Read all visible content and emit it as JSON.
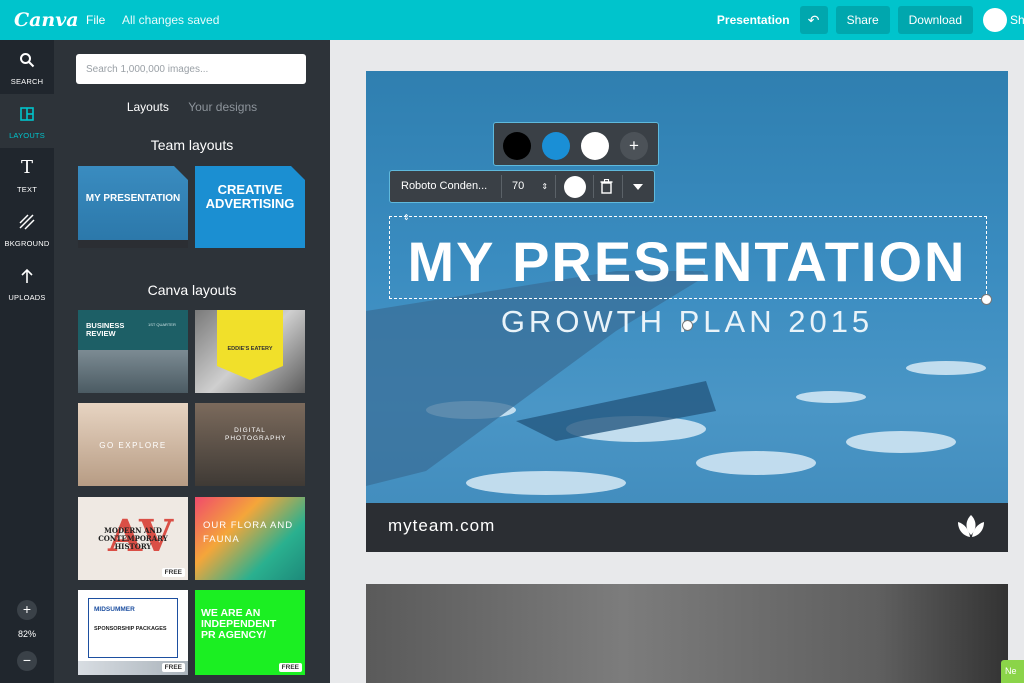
{
  "app": {
    "logo": "Canva",
    "menu_file": "File",
    "save_status": "All changes saved",
    "doc_type": "Presentation",
    "share_label": "Share",
    "download_label": "Download",
    "truncated_label": "Sho"
  },
  "rail": {
    "items": [
      {
        "label": "SEARCH",
        "icon": "search-icon"
      },
      {
        "label": "LAYOUTS",
        "icon": "layouts-icon"
      },
      {
        "label": "TEXT",
        "icon": "text-icon"
      },
      {
        "label": "BKGROUND",
        "icon": "background-icon"
      },
      {
        "label": "UPLOADS",
        "icon": "upload-icon"
      }
    ],
    "zoom_in": "+",
    "zoom_out": "−",
    "zoom_level": "82%"
  },
  "panel": {
    "search_placeholder": "Search 1,000,000 images...",
    "tabs": [
      "Layouts",
      "Your designs"
    ],
    "team_layouts_title": "Team layouts",
    "canva_layouts_title": "Canva layouts",
    "team_thumbs": [
      "MY PRESENTATION",
      "CREATIVE ADVERTISING"
    ],
    "canva_thumbs": [
      {
        "text": "BUSINESS REVIEW",
        "sub": "1ST QUARTER"
      },
      {
        "text": "EDDIE'S EATERY",
        "sub": ""
      },
      {
        "text": "GO EXPLORE",
        "sub": ""
      },
      {
        "text": "DIGITAL PHOTOGRAPHY",
        "sub": ""
      },
      {
        "text": "MODERN AND CONTEMPORARY HISTORY",
        "sub": "",
        "free": "FREE"
      },
      {
        "text": "OUR FLORA AND FAUNA",
        "sub": ""
      },
      {
        "text": "MIDSUMMER",
        "sub": "SPONSORSHIP PACKAGES",
        "free": "FREE"
      },
      {
        "text": "WE ARE AN INDEPENDENT PR AGENCY/",
        "sub": "",
        "free": "FREE"
      }
    ]
  },
  "slide": {
    "headline": "MY PRESENTATION",
    "subheadline": "GROWTH PLAN 2015",
    "footer_url": "myteam.com",
    "footer_icon": "leaf-logo-icon"
  },
  "color_toolbar": {
    "swatches": [
      "#000000",
      "#1a8fd6",
      "#ffffff"
    ],
    "add_label": "+"
  },
  "text_toolbar": {
    "font": "Roboto Conden...",
    "size": "70",
    "text_color": "#ffffff"
  },
  "corner_badge": "Ne"
}
